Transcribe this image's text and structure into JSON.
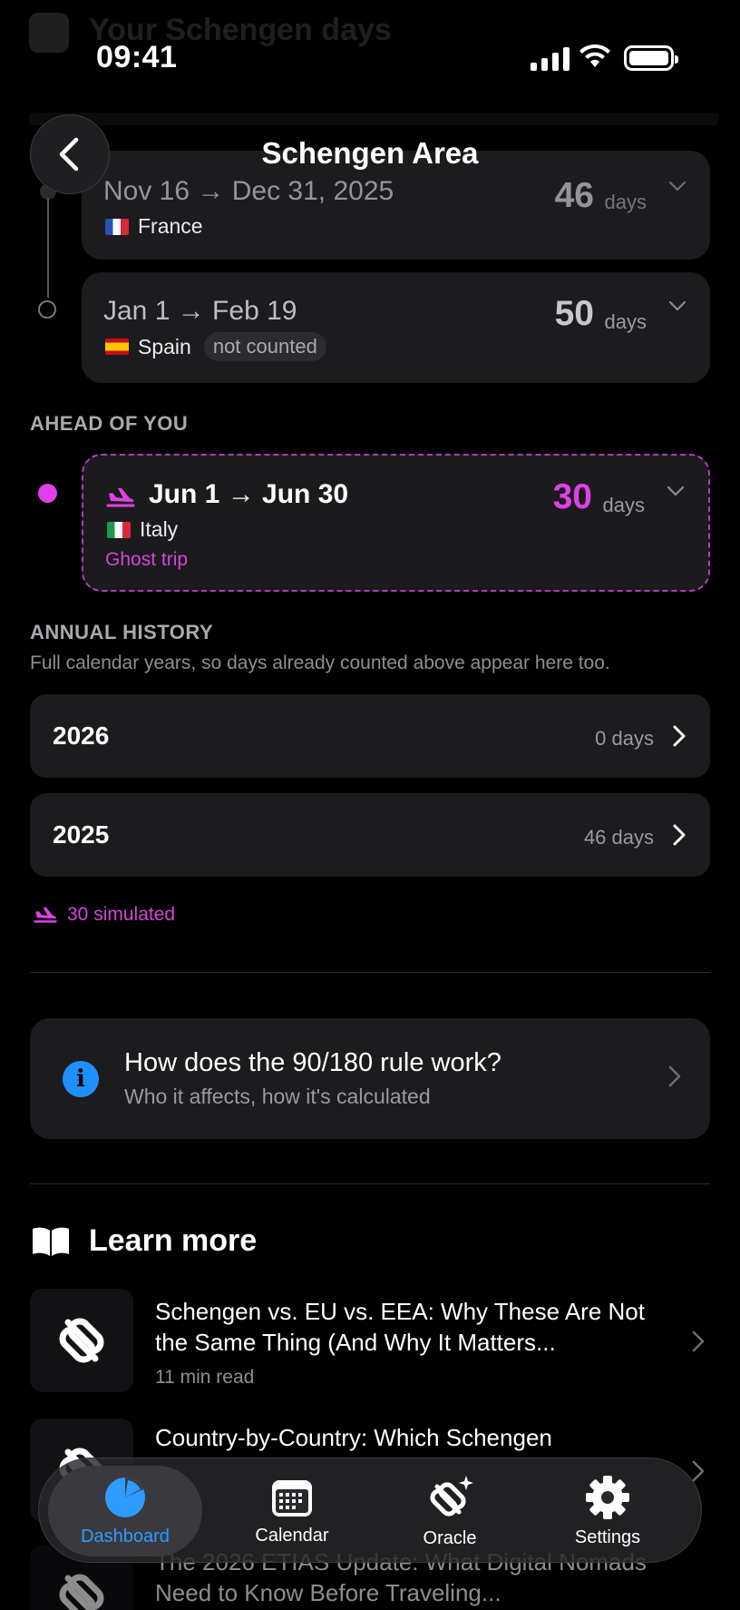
{
  "status_bar": {
    "time": "09:41"
  },
  "ghost_header": {
    "title": "Your Schengen days"
  },
  "nav": {
    "title": "Schengen Area",
    "back_icon": "chevron-left-icon"
  },
  "stays_past": [
    {
      "dates": "Nov 16 → Dec 31, 2025",
      "country": "France",
      "flag": "fr",
      "days": "46",
      "unit": "days"
    },
    {
      "dates": "Jan 1 → Feb 19",
      "country": "Spain",
      "flag": "es",
      "days": "50",
      "unit": "days",
      "badge": "not counted"
    }
  ],
  "ahead": {
    "label": "AHEAD OF YOU",
    "trip": {
      "dates": "Jun 1 → Jun 30",
      "country": "Italy",
      "flag": "it",
      "days": "30",
      "unit": "days",
      "tag": "Ghost trip"
    }
  },
  "annual_history": {
    "label": "ANNUAL HISTORY",
    "subtitle": "Full calendar years, so days already counted above appear here too.",
    "years": [
      {
        "year": "2026",
        "days": "0 days"
      },
      {
        "year": "2025",
        "days": "46 days"
      }
    ],
    "simulated": "30 simulated"
  },
  "info": {
    "question": "How does the 90/180 rule work?",
    "answer": "Who it affects, how it's calculated"
  },
  "learn_more": {
    "title": "Learn more",
    "articles": [
      {
        "title": "Schengen vs. EU vs. EEA: Why These Are Not the Same Thing (And Why It Matters...",
        "read_time": "11 min read"
      },
      {
        "title": "Country-by-Country: Which Schengen",
        "read_time": ""
      },
      {
        "title": "The 2026 ETIAS Update: What Digital Nomads Need to Know Before Traveling...",
        "read_time": ""
      }
    ]
  },
  "tabbar": {
    "tabs": [
      {
        "label": "Dashboard",
        "icon": "pie-chart-icon",
        "active": true
      },
      {
        "label": "Calendar",
        "icon": "calendar-icon",
        "active": false
      },
      {
        "label": "Oracle",
        "icon": "oracle-icon",
        "active": false
      },
      {
        "label": "Settings",
        "icon": "gear-icon",
        "active": false
      }
    ]
  },
  "colors": {
    "accent_ghost": "#e040e8",
    "accent_blue": "#2e9bff",
    "card_bg": "#1c1c1e"
  }
}
